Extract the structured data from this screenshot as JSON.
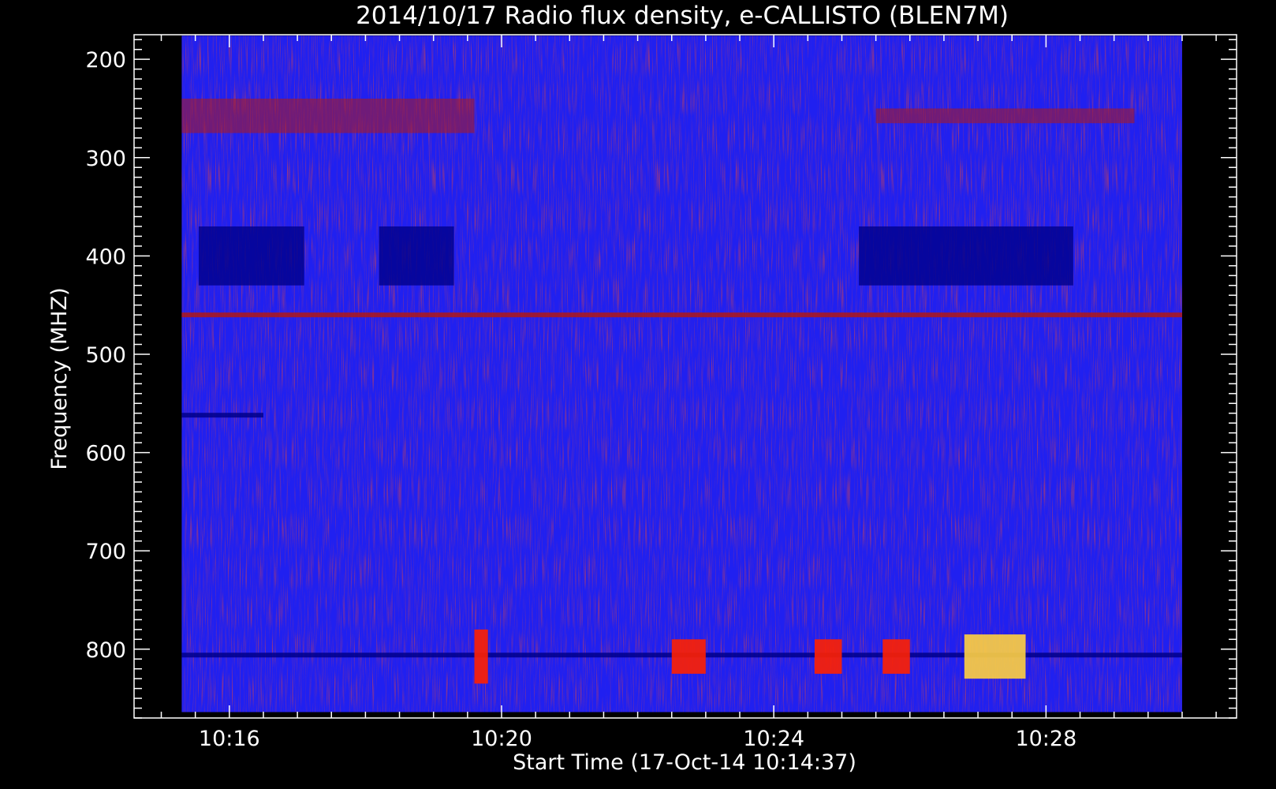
{
  "chart_data": {
    "type": "heatmap",
    "title": "2014/10/17  Radio flux density, e-CALLISTO (BLEN7M)",
    "xlabel": "Start Time (17-Oct-14 10:14:37)",
    "ylabel": "Frequency (MHZ)",
    "x_ticks": [
      "10:16",
      "10:20",
      "10:24",
      "10:28"
    ],
    "x_tick_minutes": [
      16,
      20,
      24,
      28
    ],
    "x_range_minutes": [
      15.3,
      30.0
    ],
    "xlim_minutes": [
      14.6,
      30.8
    ],
    "y_ticks": [
      200,
      300,
      400,
      500,
      600,
      700,
      800
    ],
    "ylim": [
      175,
      870
    ],
    "data_freq_range": [
      176,
      864
    ],
    "colors": {
      "background": "#000000",
      "base": "#2020f0",
      "low": "#00008a",
      "mid": "#b01818",
      "high": "#ff2000",
      "peak": "#ffd040"
    },
    "features": [
      {
        "kind": "band",
        "freq": [
          240,
          275
        ],
        "time": [
          15.3,
          19.6
        ],
        "level": "mid"
      },
      {
        "kind": "band",
        "freq": [
          250,
          265
        ],
        "time": [
          25.5,
          29.3
        ],
        "level": "mid"
      },
      {
        "kind": "block",
        "freq": [
          370,
          430
        ],
        "time": [
          15.55,
          17.1
        ],
        "level": "low"
      },
      {
        "kind": "block",
        "freq": [
          370,
          430
        ],
        "time": [
          18.2,
          19.3
        ],
        "level": "low"
      },
      {
        "kind": "block",
        "freq": [
          370,
          430
        ],
        "time": [
          25.25,
          28.4
        ],
        "level": "low"
      },
      {
        "kind": "line",
        "freq": 460,
        "time": [
          15.3,
          30.0
        ],
        "level": "mid"
      },
      {
        "kind": "line",
        "freq": 562,
        "time": [
          15.3,
          16.5
        ],
        "level": "low"
      },
      {
        "kind": "line",
        "freq": 806,
        "time": [
          15.3,
          30.0
        ],
        "level": "low"
      },
      {
        "kind": "burst",
        "freq": [
          780,
          835
        ],
        "time": [
          19.6,
          19.8
        ],
        "level": "high"
      },
      {
        "kind": "burst",
        "freq": [
          785,
          830
        ],
        "time": [
          26.8,
          27.7
        ],
        "level": "peak"
      },
      {
        "kind": "burst",
        "freq": [
          790,
          825
        ],
        "time": [
          25.6,
          26.0
        ],
        "level": "high"
      },
      {
        "kind": "burst",
        "freq": [
          790,
          825
        ],
        "time": [
          22.5,
          23.0
        ],
        "level": "high"
      },
      {
        "kind": "burst",
        "freq": [
          790,
          825
        ],
        "time": [
          24.6,
          25.0
        ],
        "level": "high"
      }
    ]
  }
}
